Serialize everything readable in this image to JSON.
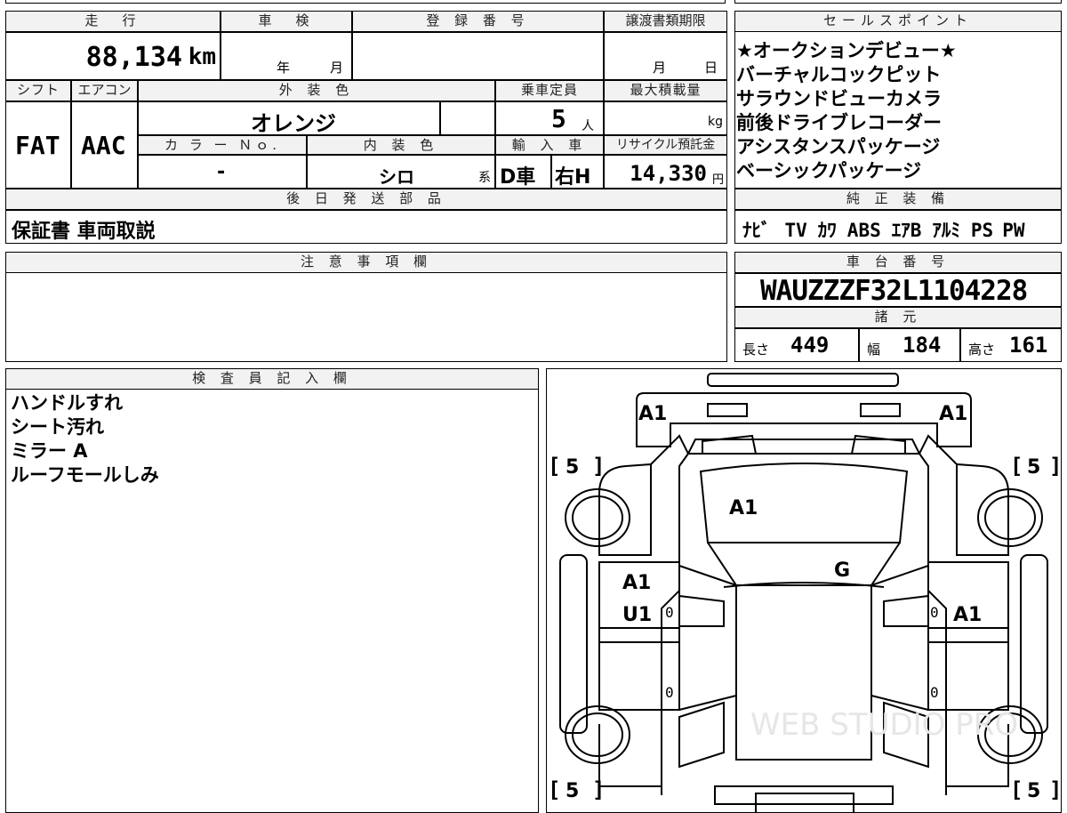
{
  "headers": {
    "mileage": "走　行",
    "shaken": "車　検",
    "reg_no": "登 録 番 号",
    "transfer_deadline": "譲渡書類期限",
    "sales_points": "セールスポイント",
    "shift": "シフト",
    "aircon": "エアコン",
    "ext_color": "外 装 色",
    "capacity": "乗車定員",
    "max_load": "最大積載量",
    "color_no": "カ ラ ー Ｎｏ.",
    "int_color": "内 装 色",
    "import": "輸 入 車",
    "recycle": "リサイクル預託金",
    "later_parts": "後 日 発 送 部 品",
    "genuine": "純 正 装 備",
    "notes": "注 意 事 項 欄",
    "chassis": "車 台 番 号",
    "specs": "諸 元",
    "inspector": "検 査 員 記 入 欄"
  },
  "values": {
    "mileage": "88,134",
    "mileage_unit": "km",
    "shaken_year": "年",
    "shaken_month": "月",
    "transfer_month": "月",
    "transfer_day": "日",
    "shift": "FAT",
    "aircon": "AAC",
    "ext_color": "オレンジ",
    "capacity": "5",
    "capacity_unit": "人",
    "max_load_unit": "kg",
    "color_no": "-",
    "int_color": "シロ",
    "int_color_suffix": "系",
    "import_type": "D車",
    "steering": "右H",
    "recycle_fee": "14,330",
    "recycle_unit": "円",
    "later_parts": "保証書 車両取説",
    "chassis_no": "WAUZZZF32L1104228",
    "length_label": "長さ",
    "length": "449",
    "width_label": "幅",
    "width": "184",
    "height_label": "高さ",
    "height": "161"
  },
  "sales_points": [
    "★オークションデビュー★",
    "バーチャルコックピット",
    "サラウンドビューカメラ",
    "前後ドライブレコーダー",
    "アシスタンスパッケージ",
    "ベーシックパッケージ"
  ],
  "genuine_equipment": [
    "ﾅﾋﾞ",
    "TV",
    "ｶﾜ",
    "ABS",
    "ｴｱB",
    "ｱﾙﾐ",
    "PS",
    "PW"
  ],
  "inspector_notes": [
    "ハンドルすれ",
    "シート汚れ",
    "ミラー A",
    "ルーフモールしみ"
  ],
  "diagram_marks": {
    "front_left": "A1",
    "front_right": "A1",
    "windshield": "A1",
    "roof": "G",
    "left_front_door_1": "A1",
    "left_front_door_2": "U1",
    "right_front_door": "A1",
    "tire_fl": "5",
    "tire_fr": "5",
    "tire_rl": "5",
    "tire_rr": "5",
    "door_small_mark": "0"
  },
  "watermark": "WEB STUDIO PRO"
}
